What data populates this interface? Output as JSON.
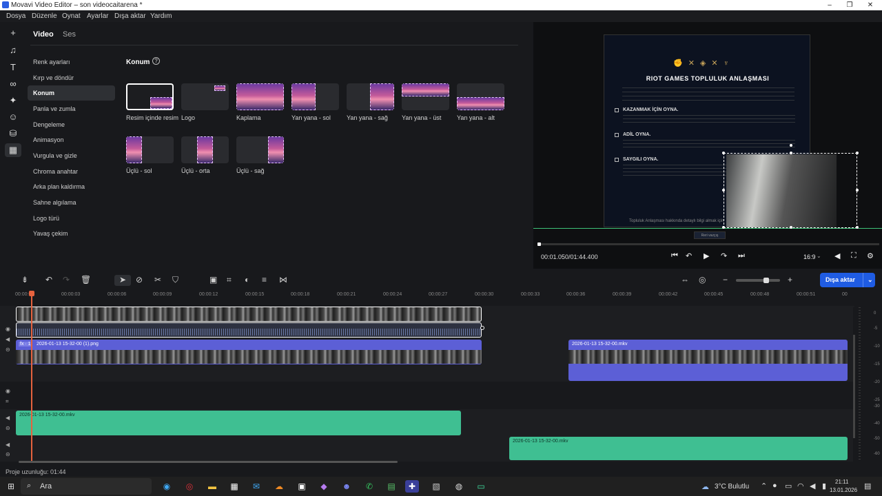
{
  "window": {
    "title": "Movavi Video Editor – son videocaitarena *"
  },
  "menu": [
    "Dosya",
    "Düzenle",
    "Oynat",
    "Ayarlar",
    "Dışa aktar",
    "Yardım"
  ],
  "panel": {
    "tabs": [
      "Video",
      "Ses"
    ],
    "sidebar": [
      "Renk ayarları",
      "Kırp ve döndür",
      "Konum",
      "Panla ve zumla",
      "Dengeleme",
      "Animasyon",
      "Vurgula ve gizle",
      "Chroma anahtar",
      "Arka plan kaldırma",
      "Sahne algılama",
      "Logo türü",
      "Yavaş çekim"
    ],
    "section_title": "Konum",
    "help_icon": "?",
    "layouts": [
      "Resim içinde resim",
      "Logo",
      "Kaplama",
      "Yan yana - sol",
      "Yan yana - sağ",
      "Yan yana - üst",
      "Yan yana - alt",
      "Üçlü - sol",
      "Üçlü - orta",
      "Üçlü - sağ"
    ]
  },
  "preview": {
    "doc_title": "RIOT GAMES TOPLULUK ANLAŞMASI",
    "headings": [
      "KAZANMAK İÇİN OYNA.",
      "ADİL OYNA.",
      "SAYGILI OYNA."
    ],
    "footer": "Topluluk Anlaşması hakkında detaylı bilgi almak için",
    "button": "Reri vazçış",
    "timecode": "00:01.050/01:44.400",
    "ratio": "16:9"
  },
  "timeline": {
    "ticks": [
      "00:00:00",
      "00:00:03",
      "00:00:06",
      "00:00:09",
      "00:00:12",
      "00:00:15",
      "00:00:18",
      "00:00:21",
      "00:00:24",
      "00:00:27",
      "00:00:30",
      "00:00:33",
      "00:00:36",
      "00:00:39",
      "00:00:42",
      "00:00:45",
      "00:00:48",
      "00:00:51",
      "00"
    ],
    "clips": {
      "png": "2026-01-13 15-32-00 (1).png",
      "mkv1": "2026-01-13 15-32-00.mkv",
      "mkv2": "2026-01-13 15-32-00.mkv",
      "mkv3": "2026-01-13 15-32-00.mkv"
    },
    "fx": "fx · 1",
    "meter": [
      "0",
      "-5",
      "-10",
      "-15",
      "-20",
      "-25",
      "-30",
      "-40",
      "-50",
      "-60"
    ],
    "export_label": "Dışa aktar",
    "project_length": "Proje uzunluğu: 01:44"
  },
  "taskbar": {
    "search": "Ara",
    "weather": "3°C  Bulutlu",
    "time": "21:11",
    "date": "13.01.2026"
  }
}
